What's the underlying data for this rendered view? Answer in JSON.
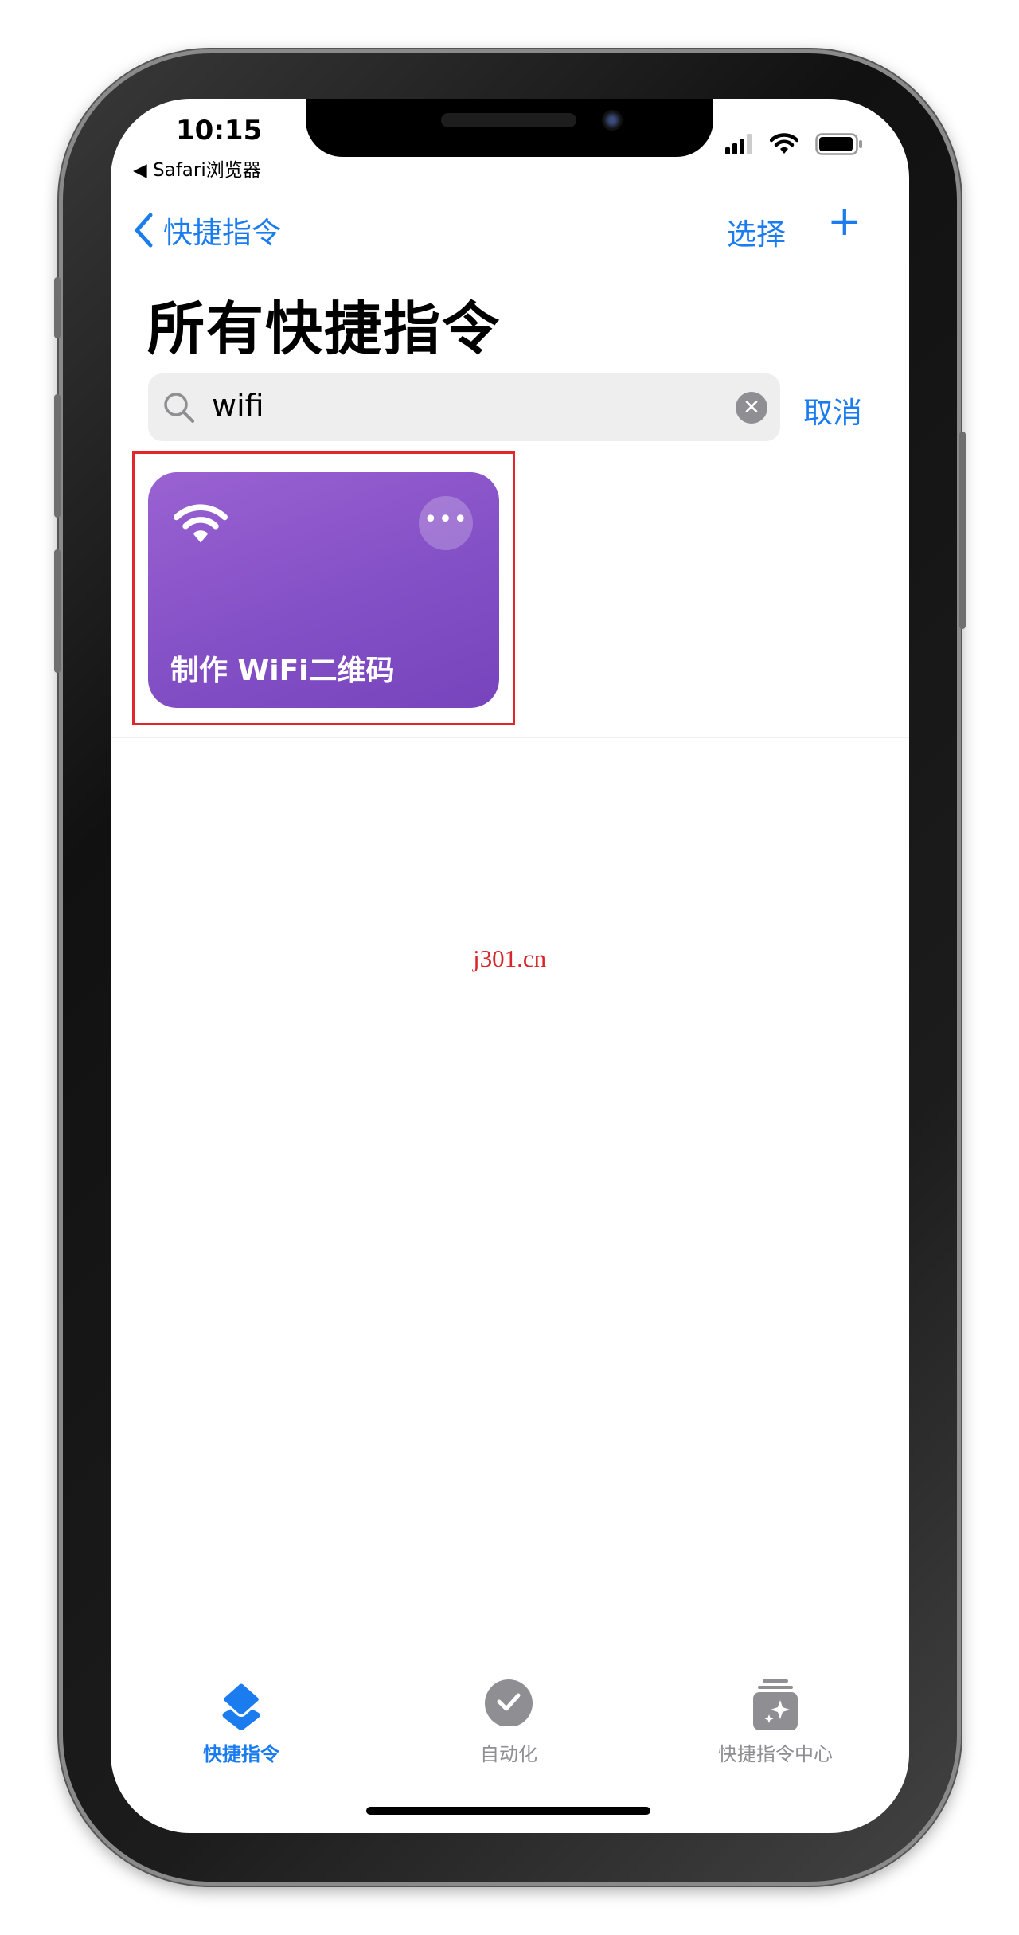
{
  "status_bar": {
    "time": "10:15",
    "back_app": "◀ Safari浏览器",
    "icons": [
      "signal-icon",
      "wifi-icon",
      "battery-icon"
    ]
  },
  "nav": {
    "back_label": "快捷指令",
    "select_label": "选择",
    "add_label": "+"
  },
  "page_title": "所有快捷指令",
  "search": {
    "value": "wifi",
    "cancel_label": "取消"
  },
  "shortcuts": [
    {
      "label": "制作 WiFi二维码",
      "icon": "wifi-icon",
      "color": "#8450c6",
      "more_label": "•••"
    }
  ],
  "watermark": "j301.cn",
  "tab_bar": {
    "items": [
      {
        "label": "快捷指令",
        "icon": "layers-icon",
        "active": true
      },
      {
        "label": "自动化",
        "icon": "clock-check-icon",
        "active": false
      },
      {
        "label": "快捷指令中心",
        "icon": "gallery-sparkle-icon",
        "active": false
      }
    ]
  },
  "colors": {
    "accent": "#1b7cf0",
    "inactive": "#8e8e93",
    "highlight": "#e3262b"
  }
}
